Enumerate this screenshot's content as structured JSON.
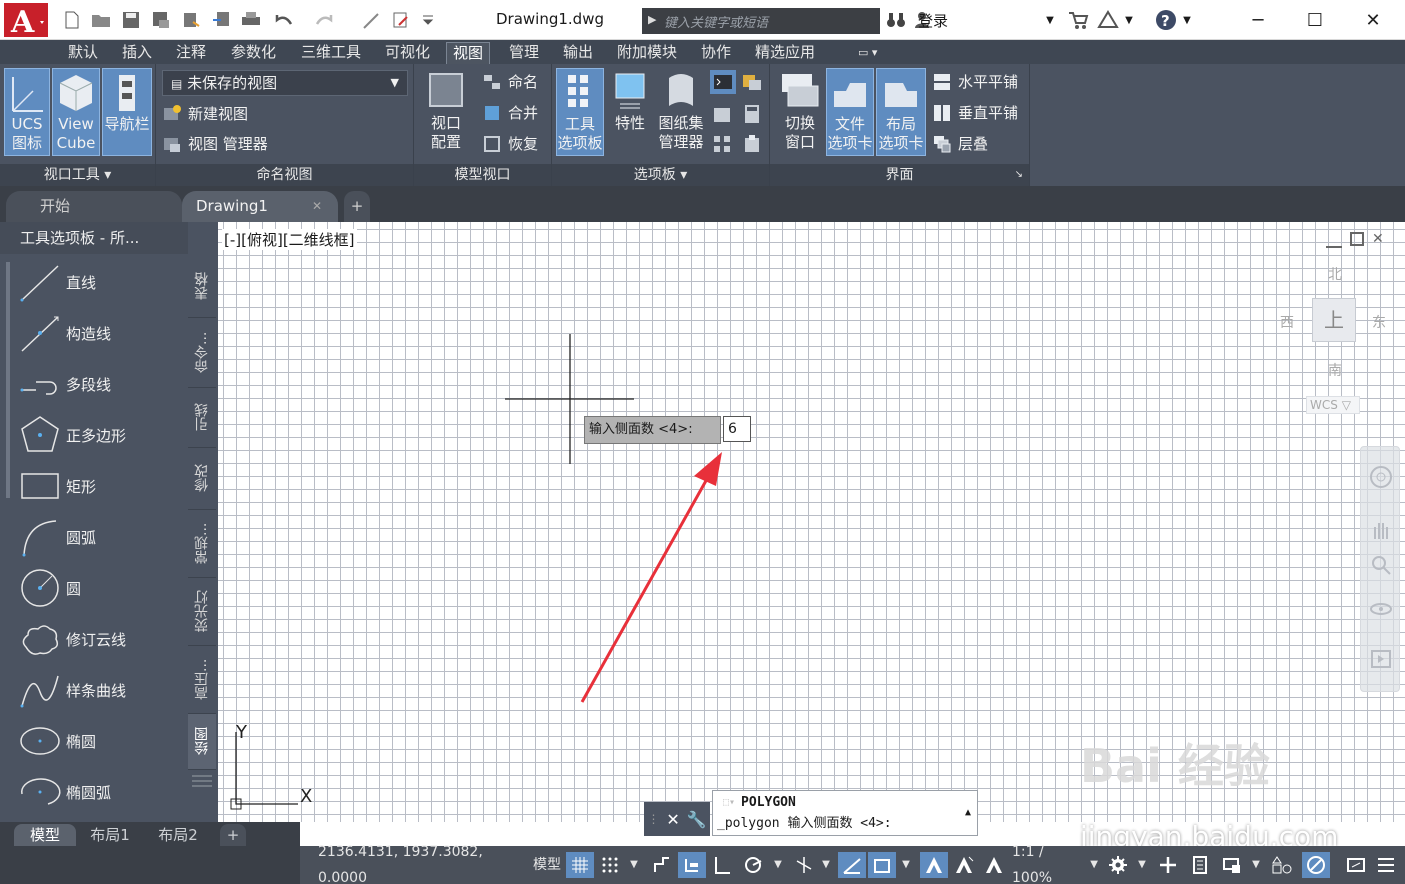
{
  "title_bar": {
    "document": "Drawing1.dwg",
    "search_placeholder": "键入关键字或短语",
    "login": "登录"
  },
  "ribbon_tabs": [
    "默认",
    "插入",
    "注释",
    "参数化",
    "三维工具",
    "可视化",
    "视图",
    "管理",
    "输出",
    "附加模块",
    "协作",
    "精选应用"
  ],
  "active_tab": "视图",
  "ribbon": {
    "viewport_tools": {
      "title": "视口工具",
      "ucs": [
        "UCS",
        "图标"
      ],
      "viewcube": [
        "View",
        "Cube"
      ],
      "navbar": "导航栏"
    },
    "named_views": {
      "title": "命名视图",
      "dropdown": "未保存的视图",
      "new_view": "新建视图",
      "view_manager": "视图 管理器"
    },
    "model_viewports": {
      "title": "模型视口",
      "config": [
        "视口",
        "配置"
      ],
      "name": "命名",
      "merge": "合并",
      "restore": "恢复"
    },
    "palettes": {
      "title": "选项板",
      "tool_palette": [
        "工具",
        "选项板"
      ],
      "properties": "特性",
      "sheetset": [
        "图纸集",
        "管理器"
      ]
    },
    "interface": {
      "title": "界面",
      "switch_window": [
        "切换",
        "窗口"
      ],
      "file_tabs": [
        "文件",
        "选项卡"
      ],
      "layout_tabs": [
        "布局",
        "选项卡"
      ],
      "tile_h": "水平平铺",
      "tile_v": "垂直平铺",
      "cascade": "层叠"
    }
  },
  "file_tabs": {
    "start": "开始",
    "drawing": "Drawing1"
  },
  "palette": {
    "title": "工具选项板 - 所...",
    "items": [
      "直线",
      "构造线",
      "多段线",
      "正多边形",
      "矩形",
      "圆弧",
      "圆",
      "修订云线",
      "样条曲线",
      "椭圆",
      "椭圆弧"
    ],
    "side_tabs": [
      "表格",
      "命令...",
      "引线",
      "修改",
      "常规...",
      "荧光灯",
      "高压...",
      "绘图"
    ]
  },
  "viewport_label": "[-][俯视][二维线框]",
  "viewcube": {
    "north": "北",
    "south": "南",
    "west": "西",
    "east": "东",
    "top": "上",
    "wcs": "WCS"
  },
  "dynamic_input": {
    "prompt": "输入侧面数 <4>:",
    "value": "6"
  },
  "command_line": {
    "command": "POLYGON",
    "history": "_polygon 输入侧面数 <4>:"
  },
  "layout_tabs": [
    "模型",
    "布局1",
    "布局2"
  ],
  "status_bar": {
    "coords": "2136.4131, 1937.3082, 0.0000",
    "model": "模型",
    "scale": "1:1 / 100%"
  },
  "axes": {
    "x": "X",
    "y": "Y"
  },
  "watermark": {
    "brand": "Bai 经验",
    "site": "jingyan.baidu.com"
  },
  "colors": {
    "ribbon": "#4b5361",
    "tabs": "#3f4753",
    "accent": "#5f8cc0",
    "arrow": "#e8303a",
    "logo": "#c8202a"
  }
}
